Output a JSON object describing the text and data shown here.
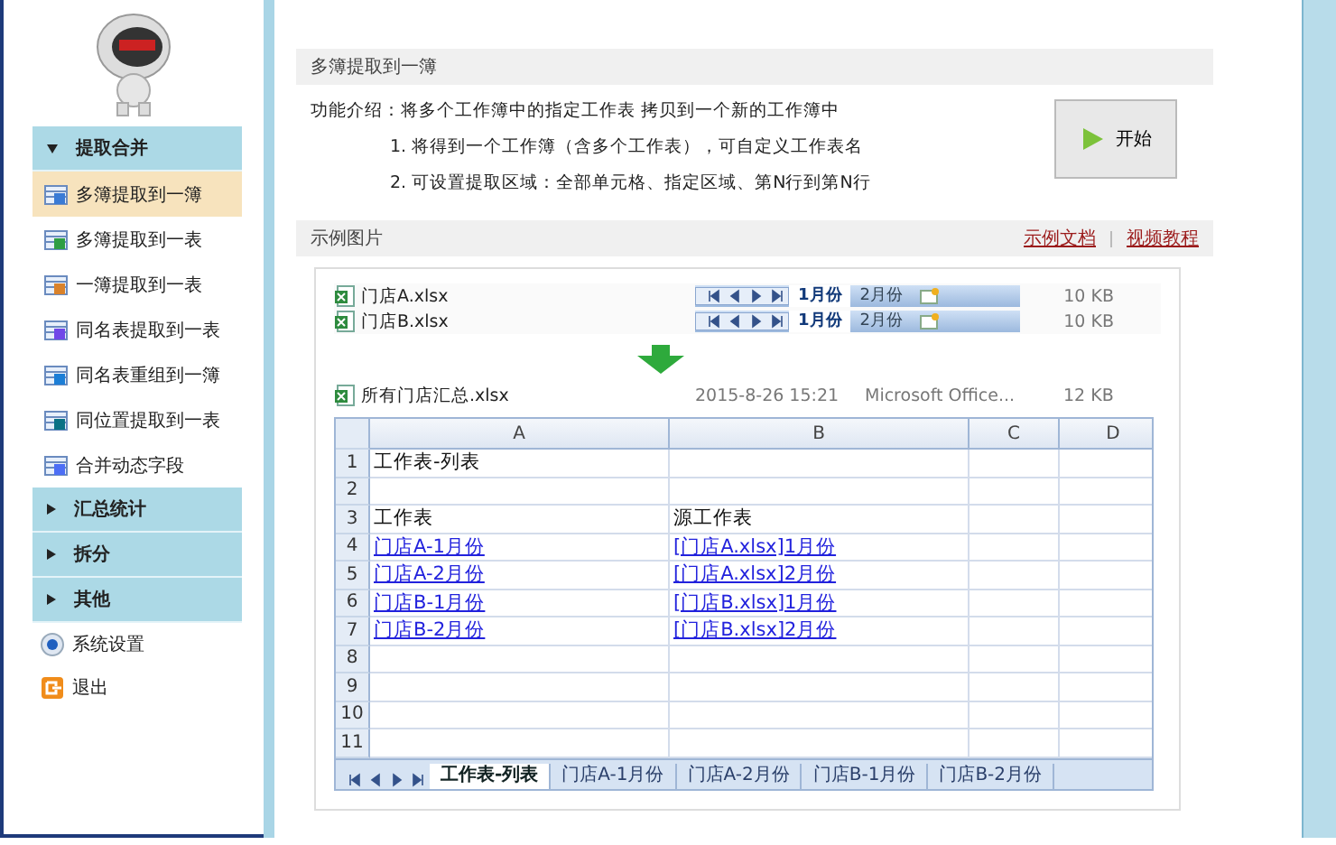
{
  "sidebar": {
    "groups": [
      {
        "label": "提取合并",
        "expanded": true,
        "items": [
          {
            "label": "多簿提取到一簿",
            "selected": true
          },
          {
            "label": "多簿提取到一表",
            "selected": false
          },
          {
            "label": "一簿提取到一表",
            "selected": false
          },
          {
            "label": "同名表提取到一表",
            "selected": false
          },
          {
            "label": "同名表重组到一簿",
            "selected": false
          },
          {
            "label": "同位置提取到一表",
            "selected": false
          },
          {
            "label": "合并动态字段",
            "selected": false
          }
        ]
      },
      {
        "label": "汇总统计",
        "expanded": false
      },
      {
        "label": "拆分",
        "expanded": false
      },
      {
        "label": "其他",
        "expanded": false
      }
    ],
    "actions": [
      {
        "label": "系统设置",
        "kind": "settings"
      },
      {
        "label": "退出",
        "kind": "exit"
      }
    ]
  },
  "feature": {
    "title": "多簿提取到一簿",
    "intro": "功能介绍：将多个工作簿中的指定工作表 拷贝到一个新的工作簿中",
    "points": [
      "1. 将得到一个工作簿（含多个工作表），可自定义工作表名",
      "2. 可设置提取区域：全部单元格、指定区域、第N行到第N行"
    ],
    "button": "开始"
  },
  "example": {
    "title": "示例图片",
    "links": [
      "示例文档",
      "视频教程"
    ],
    "source_files": [
      {
        "name": "门店A.xlsx",
        "tabs": [
          {
            "label": "1月份",
            "selected": true
          },
          {
            "label": "2月份",
            "selected": false
          }
        ],
        "size": "10 KB"
      },
      {
        "name": "门店B.xlsx",
        "tabs": [
          {
            "label": "1月份",
            "selected": true
          },
          {
            "label": "2月份",
            "selected": false
          }
        ],
        "size": "10 KB"
      }
    ],
    "result_file": {
      "name": "所有门店汇总.xlsx",
      "date": "2015-8-26 15:21",
      "type": "Microsoft Office...",
      "size": "12 KB"
    },
    "sheet": {
      "tabs": [
        {
          "label": "工作表-列表",
          "selected": true
        },
        {
          "label": "门店A-1月份",
          "selected": false
        },
        {
          "label": "门店A-2月份",
          "selected": false
        },
        {
          "label": "门店B-1月份",
          "selected": false
        },
        {
          "label": "门店B-2月份",
          "selected": false
        }
      ],
      "columns": [
        "A",
        "B",
        "C",
        "D"
      ],
      "rows": [
        {
          "number": "1",
          "cells": [
            {
              "text": "工作表-列表",
              "kind": "text"
            }
          ]
        },
        {
          "number": "2"
        },
        {
          "number": "3",
          "cells": [
            {
              "text": "工作表",
              "kind": "text"
            },
            {
              "text": "源工作表",
              "kind": "text"
            }
          ]
        },
        {
          "number": "4",
          "cells": [
            {
              "text": "门店A-1月份",
              "kind": "link"
            },
            {
              "text": "[门店A.xlsx]1月份",
              "kind": "link"
            }
          ]
        },
        {
          "number": "5",
          "cells": [
            {
              "text": "门店A-2月份",
              "kind": "link"
            },
            {
              "text": "[门店A.xlsx]2月份",
              "kind": "link"
            }
          ]
        },
        {
          "number": "6",
          "cells": [
            {
              "text": "门店B-1月份",
              "kind": "link"
            },
            {
              "text": "[门店B.xlsx]1月份",
              "kind": "link"
            }
          ]
        },
        {
          "number": "7",
          "cells": [
            {
              "text": "门店B-2月份",
              "kind": "link"
            },
            {
              "text": "[门店B.xlsx]2月份",
              "kind": "link"
            }
          ]
        },
        {
          "number": "8"
        },
        {
          "number": "9"
        },
        {
          "number": "10"
        },
        {
          "number": "11"
        }
      ]
    }
  }
}
